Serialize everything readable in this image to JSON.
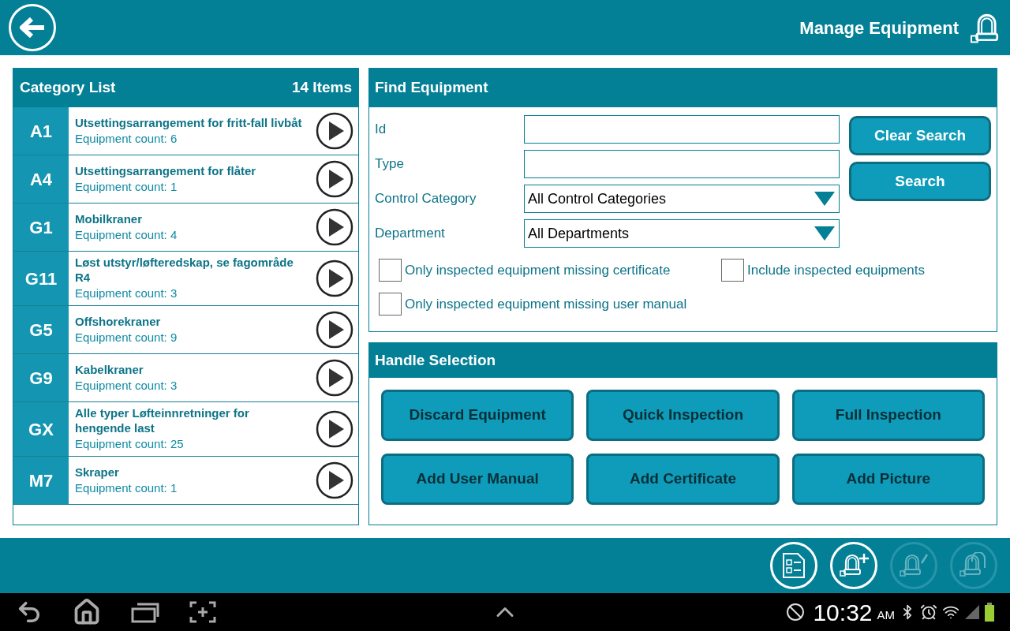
{
  "header": {
    "title": "Manage Equipment"
  },
  "category_list": {
    "title": "Category List",
    "count": "14 Items",
    "items": [
      {
        "code": "A1",
        "name": "Utsettingsarrangement for fritt-fall livbåt",
        "count": "Equipment count: 6"
      },
      {
        "code": "A4",
        "name": "Utsettingsarrangement for flåter",
        "count": "Equipment count: 1"
      },
      {
        "code": "G1",
        "name": "Mobilkraner",
        "count": "Equipment count: 4"
      },
      {
        "code": "G11",
        "name": "Løst utstyr/løfteredskap, se fagområde R4",
        "count": "Equipment count: 3"
      },
      {
        "code": "G5",
        "name": "Offshorekraner",
        "count": "Equipment count: 9"
      },
      {
        "code": "G9",
        "name": "Kabelkraner",
        "count": "Equipment count: 3"
      },
      {
        "code": "GX",
        "name": "Alle typer Løfteinnretninger for hengende last",
        "count": "Equipment count: 25"
      },
      {
        "code": "M7",
        "name": "Skraper",
        "count": "Equipment count: 1"
      }
    ]
  },
  "find_equipment": {
    "title": "Find Equipment",
    "fields": [
      {
        "kind": "text",
        "label": "Id"
      },
      {
        "kind": "text",
        "label": "Type"
      },
      {
        "kind": "select",
        "label": "Control Category",
        "value": "All Control Categories"
      },
      {
        "kind": "select",
        "label": "Department",
        "value": "All Departments"
      }
    ],
    "buttons": [
      "Clear Search",
      "Search"
    ],
    "checkboxes": [
      {
        "label": "Only inspected equipment missing certificate",
        "checked": false
      },
      {
        "label": "Include inspected equipments",
        "checked": false
      },
      {
        "label": "Only inspected equipment missing user manual",
        "checked": false
      }
    ]
  },
  "handle_selection": {
    "title": "Handle Selection",
    "buttons": [
      "Discard Equipment",
      "Quick Inspection",
      "Full Inspection",
      "Add User Manual",
      "Add Certificate",
      "Add Picture"
    ]
  },
  "toolbar": {
    "actions": [
      {
        "kind": "checklist",
        "disabled": false
      },
      {
        "kind": "add",
        "disabled": false
      },
      {
        "kind": "edit",
        "disabled": true
      },
      {
        "kind": "multiple",
        "disabled": true
      }
    ]
  },
  "status_bar": {
    "time": "10:32",
    "period": "AM"
  }
}
